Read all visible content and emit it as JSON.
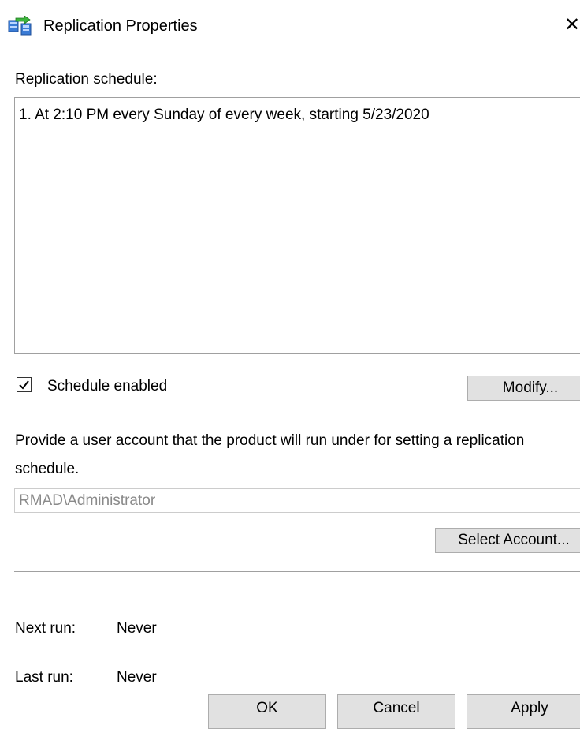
{
  "window": {
    "title": "Replication Properties",
    "app_icon": "replication-icon",
    "close_glyph": "✕"
  },
  "schedule": {
    "label": "Replication schedule:",
    "items": [
      "1. At 2:10 PM every Sunday of every week, starting 5/23/2020"
    ],
    "enabled_label": "Schedule enabled",
    "enabled_checked": true,
    "modify_button": "Modify..."
  },
  "account": {
    "description": "Provide a user account that the product will run under for setting a replication schedule.",
    "value": "RMAD\\Administrator",
    "select_button": "Select Account..."
  },
  "run_info": {
    "next_run_label": "Next run:",
    "next_run_value": "Never",
    "last_run_label": "Last run:",
    "last_run_value": "Never"
  },
  "buttons": {
    "ok": "OK",
    "cancel": "Cancel",
    "apply": "Apply"
  },
  "colors": {
    "button_face": "#e1e1e1",
    "button_border": "#adadad",
    "disabled_text": "#8a8a8a",
    "border": "#a0a0a0"
  }
}
